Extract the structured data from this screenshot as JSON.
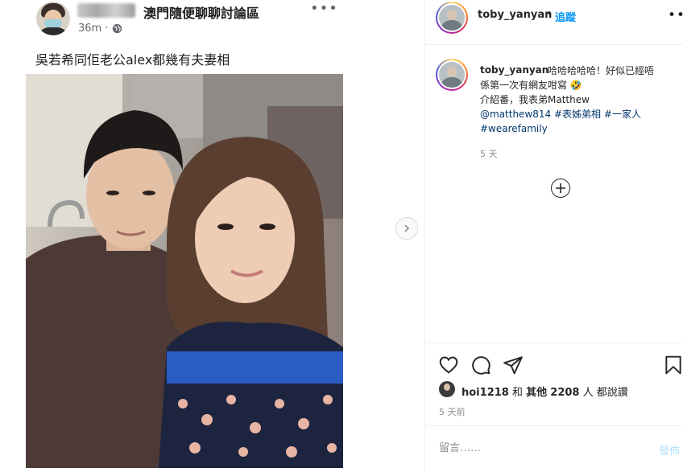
{
  "fb_post": {
    "group_name": "澳門隨便聊聊討論區",
    "time": "36m ·",
    "more_icon": "more-horizontal-icon",
    "privacy_icon": "globe-icon",
    "text": "吳若希同佢老公alex都幾有夫妻相"
  },
  "media": {
    "next_icon": "chevron-right-icon"
  },
  "header": {
    "username": "toby_yanyan",
    "separator": "•",
    "follow_label": "追蹤",
    "more_icon": "more-horizontal-icon"
  },
  "caption": {
    "username": "toby_yanyan",
    "line1_text": "哈哈哈哈哈！好似已經唔",
    "line2_text": "係第一次有網友咁寫",
    "line2_emoji": "🤣",
    "line3_text": "介紹番，我表弟Matthew",
    "line4_mention": "@matthew814",
    "line4_tag1": "#表姊弟相",
    "line4_tag2": "#一家人",
    "line5_tag": "#wearefamily",
    "time": "5 天",
    "load_more_icon": "plus-circle-icon"
  },
  "actions": {
    "like_icon": "heart-icon",
    "comment_icon": "comment-icon",
    "share_icon": "paper-plane-icon",
    "save_icon": "bookmark-icon"
  },
  "likes": {
    "user": "hoi1218",
    "connector": "和",
    "others_prefix": "其他",
    "count": "2208",
    "suffix": "人 都說讚"
  },
  "post_time": "5 天前",
  "comment": {
    "placeholder": "留言……",
    "post_label": "發佈"
  },
  "colors": {
    "link_blue": "#0095f6",
    "tag_blue": "#00376b",
    "muted": "#8e8e8e",
    "post_disabled": "#b2dffc"
  }
}
